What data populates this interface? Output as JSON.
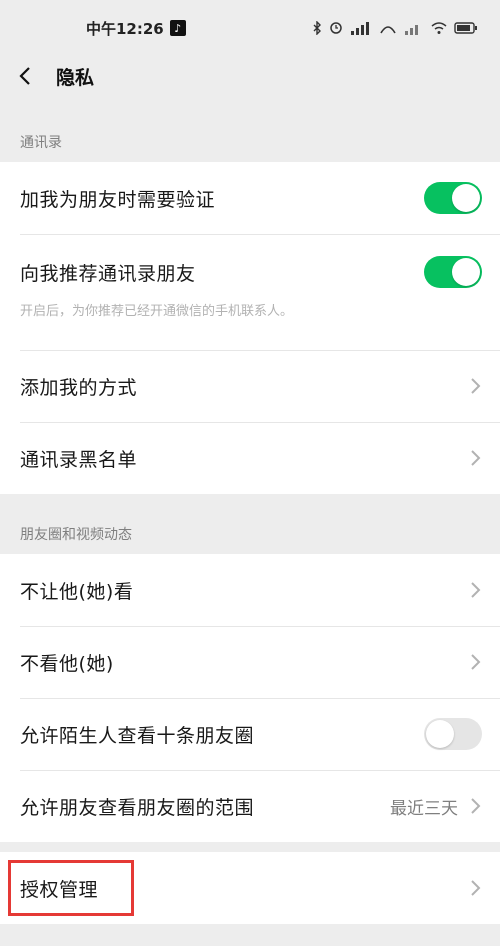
{
  "status_bar": {
    "time": "中午12:26",
    "app_badge": "♪",
    "icons": [
      "bluetooth-icon",
      "alarm-icon",
      "signal-icon",
      "wifi-icon",
      "battery-icon"
    ]
  },
  "nav": {
    "back_icon": "chevron-left-icon",
    "title": "隐私"
  },
  "sections": {
    "contacts": {
      "header": "通讯录",
      "items": [
        {
          "label": "加我为朋友时需要验证",
          "toggle": true
        },
        {
          "label": "向我推荐通讯录朋友",
          "toggle": true,
          "description": "开启后，为你推荐已经开通微信的手机联系人。"
        },
        {
          "label": "添加我的方式"
        },
        {
          "label": "通讯录黑名单"
        }
      ]
    },
    "moments": {
      "header": "朋友圈和视频动态",
      "items": [
        {
          "label": "不让他(她)看"
        },
        {
          "label": "不看他(她)"
        },
        {
          "label": "允许陌生人查看十条朋友圈",
          "toggle": false
        },
        {
          "label": "允许朋友查看朋友圈的范围",
          "value": "最近三天"
        }
      ]
    },
    "auth": {
      "items": [
        {
          "label": "授权管理"
        }
      ]
    }
  },
  "colors": {
    "switch_on": "#07c160",
    "switch_off": "#e5e5e5",
    "highlight": "#e53935",
    "background": "#ededed"
  }
}
